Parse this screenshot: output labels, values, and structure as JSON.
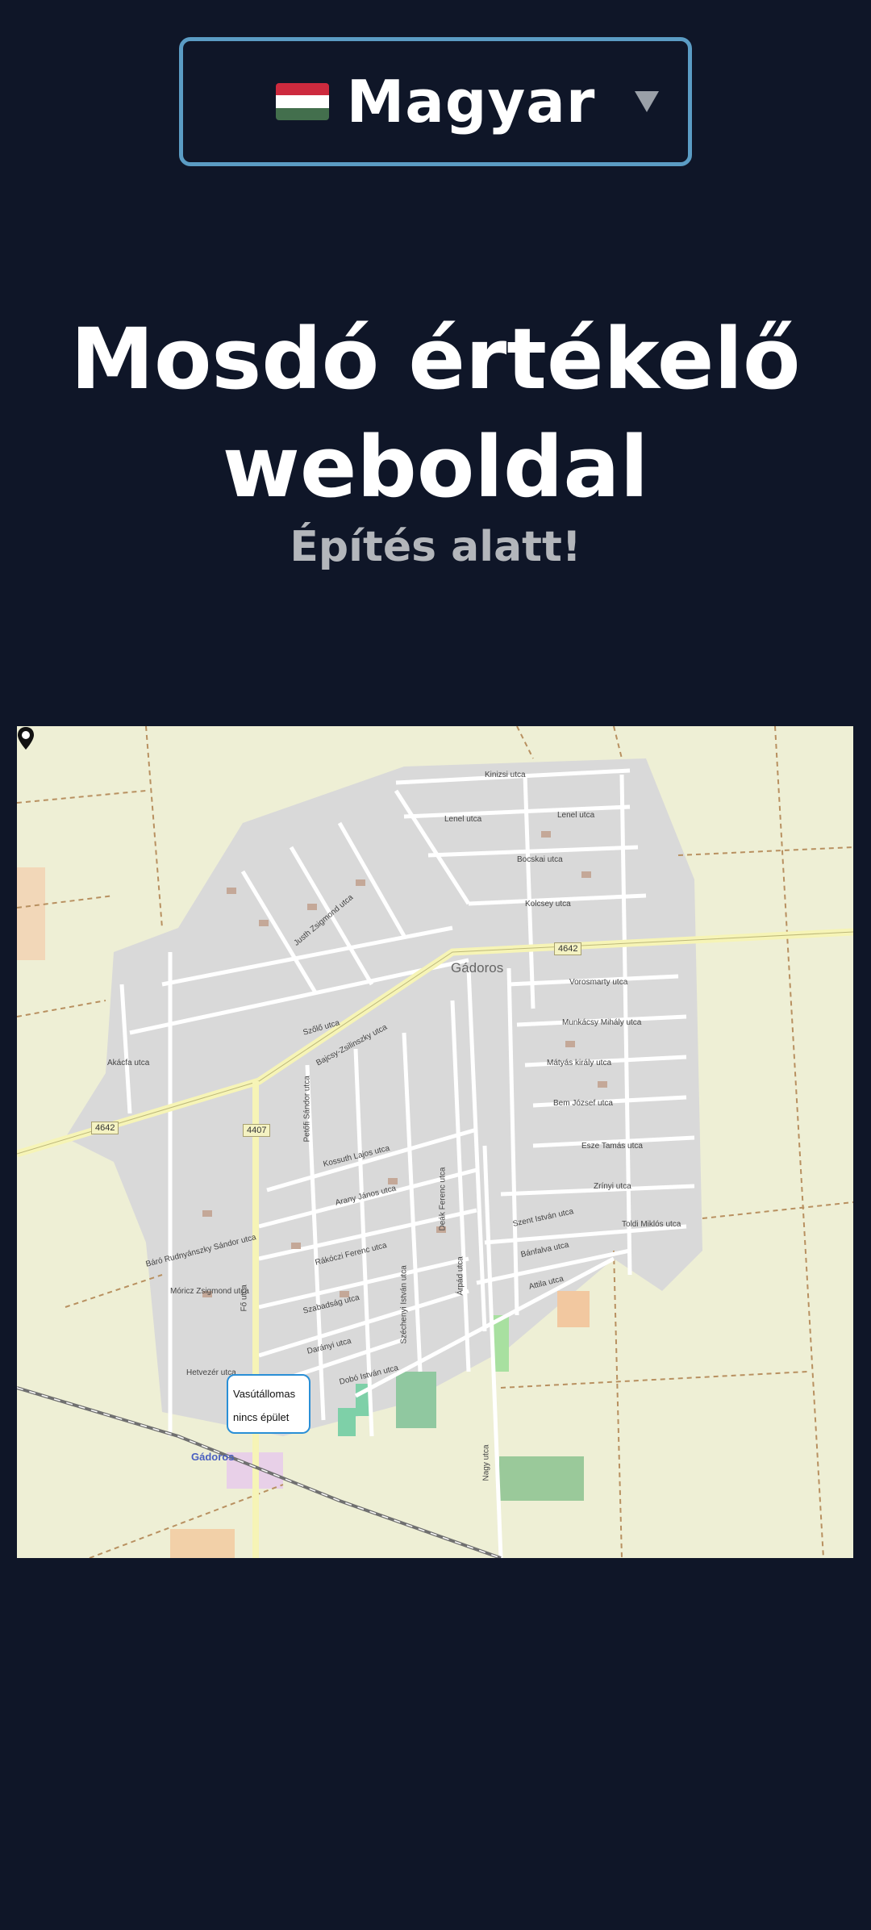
{
  "language_selector": {
    "flag_icon": "hungarian-flag-icon",
    "selected_label": "Magyar",
    "arrow_icon": "triangle-down-icon"
  },
  "header": {
    "title_line1": "Mosdó értékelő",
    "title_line2": "weboldal",
    "subtitle": "Építés alatt!"
  },
  "map": {
    "place_label": "Gádoros",
    "station_label": "Gádoros",
    "popup_line1": "Vasútállomas",
    "popup_line2": "nincs épület",
    "marker_icon": "map-pin-icon",
    "road_shields": [
      "4642",
      "4642",
      "4407"
    ],
    "streets": [
      "Kinizsi utca",
      "Lenel utca",
      "Lenel utca",
      "Bocskai utca",
      "Kolcsey utca",
      "Vorosmarty utca",
      "Munkácsy Mihály utca",
      "Mátyás király utca",
      "Bem József utca",
      "Esze Tamás utca",
      "Zrínyi utca",
      "Toldi Miklós utca",
      "Szent István utca",
      "Bánfalva utca",
      "Attila utca",
      "Bajcsy-Zsilinszky utca",
      "Kossuth Lajos utca",
      "Arany János utca",
      "Rákóczi Ferenc utca",
      "Szabadság utca",
      "Darányi utca",
      "Dobó István utca",
      "Hetvezér utca",
      "Móricz Zsigmond utca",
      "Báró Rudnyánszky Sándor utca",
      "Akácfa utca",
      "Fő utca",
      "Nagy utca",
      "Deák Ferenc utca",
      "Árpád utca",
      "Széchenyi István utca",
      "Szőlő utca",
      "Justh Zsigmond utca",
      "Petőfi Sándor utca"
    ]
  }
}
